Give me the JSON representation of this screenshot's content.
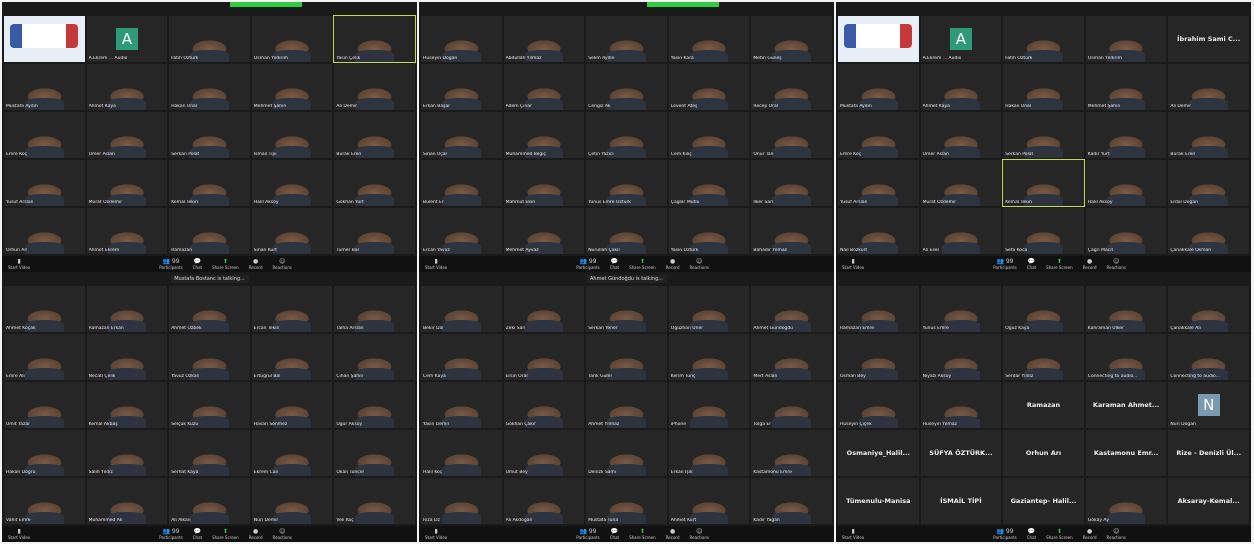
{
  "colors": {
    "accent_green": "#2ecc40",
    "bg": "#1a1a1a",
    "highlight": "#c8dc3c"
  },
  "toolbar": {
    "stop_video": "Start Video",
    "participants": "Participants",
    "participants_count": "99",
    "chat": "Chat",
    "share_screen": "Share Screen",
    "record": "Record",
    "reactions": "Reactions"
  },
  "quads": [
    {
      "speaking": "",
      "tiles": [
        {
          "kind": "logo",
          "name": ""
        },
        {
          "kind": "avatar",
          "letter": "A",
          "color": "#2e9a7a",
          "name": "A.Ekrem ... Audio"
        },
        {
          "kind": "video",
          "name": "Fatih Öztürk"
        },
        {
          "kind": "video",
          "name": "Osman Yıldırım"
        },
        {
          "kind": "video",
          "name": "Yasin Çelik",
          "active": true
        },
        {
          "kind": "video",
          "name": "Mustafa Aydın"
        },
        {
          "kind": "video",
          "name": "Ahmet Kaya"
        },
        {
          "kind": "video",
          "name": "Hakan Ünal"
        },
        {
          "kind": "video",
          "name": "Mehmet Şahin"
        },
        {
          "kind": "video",
          "name": "Ali Demir"
        },
        {
          "kind": "video",
          "name": "Emre Koç"
        },
        {
          "kind": "video",
          "name": "Ömer Aslan"
        },
        {
          "kind": "video",
          "name": "Serkan Polat"
        },
        {
          "kind": "video",
          "name": "İsmail Tipi"
        },
        {
          "kind": "video",
          "name": "Burak Eren"
        },
        {
          "kind": "video",
          "name": "Yusuf Arslan"
        },
        {
          "kind": "video",
          "name": "Murat Özdemir"
        },
        {
          "kind": "video",
          "name": "Kemal Tekin"
        },
        {
          "kind": "video",
          "name": "Halil Aksoy"
        },
        {
          "kind": "video",
          "name": "Gökhan Yurt"
        },
        {
          "kind": "video",
          "name": "Orhun Arı"
        },
        {
          "kind": "video",
          "name": "Ahmet Ekrem"
        },
        {
          "kind": "video",
          "name": "Ramazan"
        },
        {
          "kind": "video",
          "name": "Sinan Kurt"
        },
        {
          "kind": "video",
          "name": "Tümer Bal"
        }
      ]
    },
    {
      "speaking": "",
      "tiles": [
        {
          "kind": "video",
          "name": "Hüseyin Doğan"
        },
        {
          "kind": "video",
          "name": "Abdullah Yılmaz"
        },
        {
          "kind": "video",
          "name": "Selim Aydın"
        },
        {
          "kind": "video",
          "name": "Yasin Kara"
        },
        {
          "kind": "video",
          "name": "Metin Güneş"
        },
        {
          "kind": "video",
          "name": "Erkan Başar"
        },
        {
          "kind": "video",
          "name": "Adem Çınar"
        },
        {
          "kind": "video",
          "name": "Cengiz Ak"
        },
        {
          "kind": "video",
          "name": "Levent Ateş"
        },
        {
          "kind": "video",
          "name": "Recep Oral"
        },
        {
          "kind": "video",
          "name": "Sinan Uçar"
        },
        {
          "kind": "video",
          "name": "Muhammed Bilgiç"
        },
        {
          "kind": "video",
          "name": "Çetin Yazıcı"
        },
        {
          "kind": "video",
          "name": "Cem Kılıç"
        },
        {
          "kind": "video",
          "name": "Onur Tan"
        },
        {
          "kind": "video",
          "name": "Bülent Er"
        },
        {
          "kind": "video",
          "name": "Mahmut Ekin"
        },
        {
          "kind": "video",
          "name": "Yunus Emre Öztürk"
        },
        {
          "kind": "video",
          "name": "Çağlar Mutlu"
        },
        {
          "kind": "video",
          "name": "İlker Sarı"
        },
        {
          "kind": "video",
          "name": "Ercan Yavuz"
        },
        {
          "kind": "video",
          "name": "Mehmet Ayvaz"
        },
        {
          "kind": "video",
          "name": "Nurullah Çakır"
        },
        {
          "kind": "video",
          "name": "Yasin Öztürk"
        },
        {
          "kind": "video",
          "name": "Bahadır Yılmaz"
        }
      ]
    },
    {
      "speaking": "",
      "tiles": [
        {
          "kind": "logo",
          "name": ""
        },
        {
          "kind": "avatar",
          "letter": "A",
          "color": "#2e9a7a",
          "name": "A.Ekrem ... Audio"
        },
        {
          "kind": "video",
          "name": "Fatih Öztürk"
        },
        {
          "kind": "video",
          "name": "Osman Yıldırım"
        },
        {
          "kind": "name",
          "name": "İbrahim Sami C..."
        },
        {
          "kind": "video",
          "name": "Mustafa Aydın"
        },
        {
          "kind": "video",
          "name": "Ahmet Kaya"
        },
        {
          "kind": "video",
          "name": "Hakan Ünal"
        },
        {
          "kind": "video",
          "name": "Mehmet Şahin"
        },
        {
          "kind": "video",
          "name": "Ali Demir"
        },
        {
          "kind": "video",
          "name": "Emre Koç"
        },
        {
          "kind": "video",
          "name": "Ömer Aslan"
        },
        {
          "kind": "video",
          "name": "Serkan Polat"
        },
        {
          "kind": "video",
          "name": "Kadir Yurt"
        },
        {
          "kind": "video",
          "name": "Burak Eren"
        },
        {
          "kind": "video",
          "name": "Yusuf Arslan"
        },
        {
          "kind": "video",
          "name": "Murat Özdemir"
        },
        {
          "kind": "video",
          "name": "Kemal Tekin",
          "active": true
        },
        {
          "kind": "video",
          "name": "Halil Aksoy"
        },
        {
          "kind": "video",
          "name": "Erdal Doğan"
        },
        {
          "kind": "video",
          "name": "Nail Bozkurt"
        },
        {
          "kind": "video",
          "name": "Ali Eser"
        },
        {
          "kind": "video",
          "name": "Sefa Koca"
        },
        {
          "kind": "video",
          "name": "Çağrı Macit"
        },
        {
          "kind": "video",
          "name": "Çanakkale Osman"
        }
      ]
    },
    {
      "speaking": "Mustafa Bostanc is talking...",
      "tiles": [
        {
          "kind": "video",
          "name": "Ahmet Koçak"
        },
        {
          "kind": "video",
          "name": "Ramazan Erkan"
        },
        {
          "kind": "video",
          "name": "Ahmet Özbek"
        },
        {
          "kind": "video",
          "name": "Ercan Tekin"
        },
        {
          "kind": "video",
          "name": "Talha Arslan"
        },
        {
          "kind": "video",
          "name": "Emre Ali"
        },
        {
          "kind": "video",
          "name": "Necati Çelik"
        },
        {
          "kind": "video",
          "name": "Yavuz Özkan"
        },
        {
          "kind": "video",
          "name": "Ertuğrul Bal"
        },
        {
          "kind": "video",
          "name": "Cihan Şahin"
        },
        {
          "kind": "video",
          "name": "Ümit Yazar"
        },
        {
          "kind": "video",
          "name": "Kemal Akbaş"
        },
        {
          "kind": "video",
          "name": "Selçuk Kuzu"
        },
        {
          "kind": "video",
          "name": "Hasan Sönmez"
        },
        {
          "kind": "video",
          "name": "Uğur Aksoy"
        },
        {
          "kind": "video",
          "name": "Hakan Doğru"
        },
        {
          "kind": "video",
          "name": "Salih Yıldız"
        },
        {
          "kind": "video",
          "name": "Serhat Kaya"
        },
        {
          "kind": "video",
          "name": "Ekrem Can"
        },
        {
          "kind": "video",
          "name": "Okan Tuncer"
        },
        {
          "kind": "video",
          "name": "Vahit Emre"
        },
        {
          "kind": "video",
          "name": "Muhammed Ali"
        },
        {
          "kind": "video",
          "name": "Ali Alkan"
        },
        {
          "kind": "video",
          "name": "Nuri Demir"
        },
        {
          "kind": "video",
          "name": "Veli Koç"
        }
      ]
    },
    {
      "speaking": "Ahmet Gündoğdu is talking...",
      "tiles": [
        {
          "kind": "video",
          "name": "Bekir Dal"
        },
        {
          "kind": "video",
          "name": "Zeki Sarı"
        },
        {
          "kind": "video",
          "name": "Serkan Yener"
        },
        {
          "kind": "video",
          "name": "Oğuzhan Üner"
        },
        {
          "kind": "video",
          "name": "Ahmet Gündoğdu"
        },
        {
          "kind": "video",
          "name": "Cem Kaya"
        },
        {
          "kind": "video",
          "name": "Ersin Oral"
        },
        {
          "kind": "video",
          "name": "Tarık Güler"
        },
        {
          "kind": "video",
          "name": "Kerim Tunç"
        },
        {
          "kind": "video",
          "name": "Mert Aslan"
        },
        {
          "kind": "video",
          "name": "Yasin Demir"
        },
        {
          "kind": "video",
          "name": "Gökhan Çakır"
        },
        {
          "kind": "video",
          "name": "Ahmet Yılmaz"
        },
        {
          "kind": "video",
          "name": "iPhone"
        },
        {
          "kind": "video",
          "name": "Tolga Er"
        },
        {
          "kind": "video",
          "name": "Halil Koç"
        },
        {
          "kind": "video",
          "name": "Umut Bey"
        },
        {
          "kind": "video",
          "name": "Denizli Sami"
        },
        {
          "kind": "video",
          "name": "Erkan Işık"
        },
        {
          "kind": "video",
          "name": "Kastamonu Emre"
        },
        {
          "kind": "video",
          "name": "Rıza Öz"
        },
        {
          "kind": "video",
          "name": "Ali Akdoğan"
        },
        {
          "kind": "video",
          "name": "Mustafa Tuna"
        },
        {
          "kind": "video",
          "name": "Ahmet Kurt"
        },
        {
          "kind": "video",
          "name": "Kadir Yağan"
        }
      ]
    },
    {
      "speaking": "",
      "tiles": [
        {
          "kind": "video",
          "name": "Ramazan Emre"
        },
        {
          "kind": "video",
          "name": "Yunus Emre"
        },
        {
          "kind": "video",
          "name": "Oğuz Kaya"
        },
        {
          "kind": "video",
          "name": "Kahraman Ülker"
        },
        {
          "kind": "video",
          "name": "Çanakkale Ali"
        },
        {
          "kind": "video",
          "name": "Osman Bey"
        },
        {
          "kind": "video",
          "name": "Niyazi Aksoy"
        },
        {
          "kind": "video",
          "name": "Serdar Yıldız"
        },
        {
          "kind": "video",
          "name": "Connecting to audio..."
        },
        {
          "kind": "video",
          "name": "Connecting to audio..."
        },
        {
          "kind": "video",
          "name": "Hüseyin Çiçek"
        },
        {
          "kind": "video",
          "name": "Hüseyin Yılmaz"
        },
        {
          "kind": "name",
          "name": "Ramazan"
        },
        {
          "kind": "name",
          "name": "Karaman Ahmet..."
        },
        {
          "kind": "avatar",
          "letter": "N",
          "color": "#7a9ab2",
          "name": "Nuri Doğan"
        },
        {
          "kind": "name",
          "name": "Osmaniye_Halil..."
        },
        {
          "kind": "name",
          "name": "SÜFYA ÖZTÜRK..."
        },
        {
          "kind": "name",
          "name": "Orhun Arı"
        },
        {
          "kind": "name",
          "name": "Kastamonu Emr..."
        },
        {
          "kind": "name",
          "name": "Rize - Denizli Ül..."
        },
        {
          "kind": "name",
          "name": "Tümenulu-Manisa"
        },
        {
          "kind": "name",
          "name": "İSMAİL TİPİ"
        },
        {
          "kind": "name",
          "name": "Gaziantep- Halil..."
        },
        {
          "kind": "video",
          "name": "Gökay Ay"
        },
        {
          "kind": "name",
          "name": "Aksaray-Kemal..."
        }
      ]
    }
  ]
}
